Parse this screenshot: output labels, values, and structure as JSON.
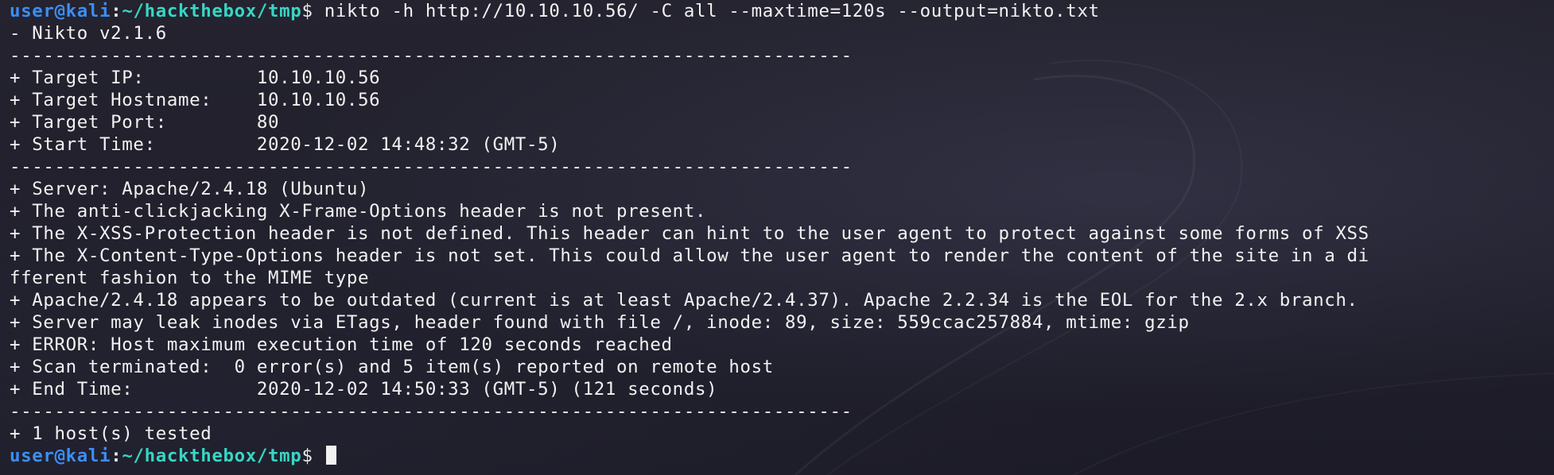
{
  "prompt": {
    "user": "user",
    "at": "@",
    "host": "kali",
    "colon": ":",
    "path": "~/hackthebox/tmp",
    "dollar": "$"
  },
  "command": " nikto -h http://10.10.10.56/ -C all --maxtime=120s --output=nikto.txt",
  "output": [
    "- Nikto v2.1.6",
    "---------------------------------------------------------------------------",
    "+ Target IP:          10.10.10.56",
    "+ Target Hostname:    10.10.10.56",
    "+ Target Port:        80",
    "+ Start Time:         2020-12-02 14:48:32 (GMT-5)",
    "---------------------------------------------------------------------------",
    "+ Server: Apache/2.4.18 (Ubuntu)",
    "+ The anti-clickjacking X-Frame-Options header is not present.",
    "+ The X-XSS-Protection header is not defined. This header can hint to the user agent to protect against some forms of XSS",
    "+ The X-Content-Type-Options header is not set. This could allow the user agent to render the content of the site in a di",
    "fferent fashion to the MIME type",
    "+ Apache/2.4.18 appears to be outdated (current is at least Apache/2.4.37). Apache 2.2.34 is the EOL for the 2.x branch.",
    "+ Server may leak inodes via ETags, header found with file /, inode: 89, size: 559ccac257884, mtime: gzip",
    "+ ERROR: Host maximum execution time of 120 seconds reached",
    "+ Scan terminated:  0 error(s) and 5 item(s) reported on remote host",
    "+ End Time:           2020-12-02 14:50:33 (GMT-5) (121 seconds)",
    "---------------------------------------------------------------------------",
    "+ 1 host(s) tested"
  ]
}
